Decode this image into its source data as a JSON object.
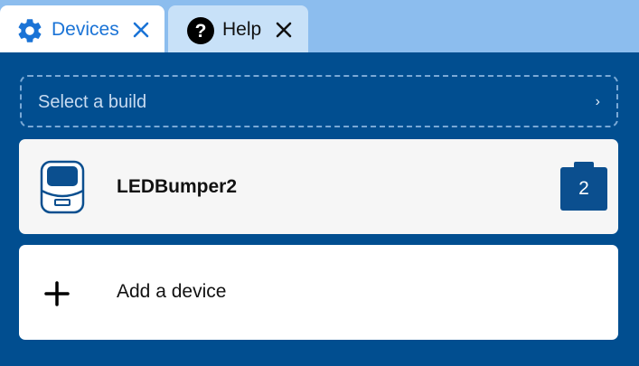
{
  "tabs": [
    {
      "label": "Devices",
      "icon": "gear-icon",
      "active": true
    },
    {
      "label": "Help",
      "icon": "help-circle-icon",
      "active": false
    }
  ],
  "build_select": {
    "placeholder": "Select a build",
    "chevron": "›"
  },
  "devices": [
    {
      "name": "LEDBumper2",
      "icon": "device-icon",
      "badge_count": "2"
    }
  ],
  "add_device": {
    "label": "Add a device",
    "icon": "plus-icon"
  },
  "colors": {
    "tabbar_bg": "#8cbdee",
    "panel_bg": "#014e90",
    "active_tab_text": "#1a73d6",
    "badge_bg": "#0b4f8f"
  }
}
